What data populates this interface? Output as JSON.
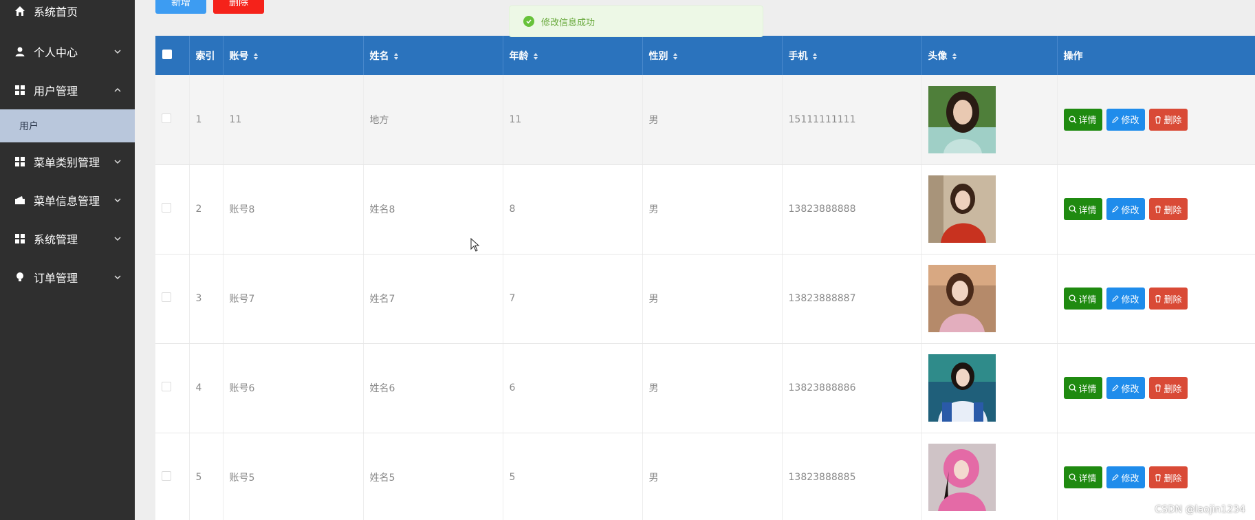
{
  "sidebar": {
    "items": [
      {
        "label": "系统首页",
        "icon": "home-icon"
      },
      {
        "label": "个人中心",
        "icon": "person-icon"
      },
      {
        "label": "用户管理",
        "icon": "grid-icon"
      },
      {
        "label": "菜单类别管理",
        "icon": "grid-icon"
      },
      {
        "label": "菜单信息管理",
        "icon": "wallet-icon"
      },
      {
        "label": "系统管理",
        "icon": "grid-icon"
      },
      {
        "label": "订单管理",
        "icon": "bulb-icon"
      }
    ],
    "sub_item": "用户"
  },
  "toolbar": {
    "add_label": "新增",
    "delete_label": "删除"
  },
  "toast": {
    "message": "修改信息成功"
  },
  "table": {
    "columns": [
      "索引",
      "账号",
      "姓名",
      "年龄",
      "性别",
      "手机",
      "头像",
      "操作"
    ],
    "rows": [
      {
        "index": "1",
        "account": "11",
        "name": "地方",
        "age": "11",
        "gender": "男",
        "phone": "15111111111"
      },
      {
        "index": "2",
        "account": "账号8",
        "name": "姓名8",
        "age": "8",
        "gender": "男",
        "phone": "13823888888"
      },
      {
        "index": "3",
        "account": "账号7",
        "name": "姓名7",
        "age": "7",
        "gender": "男",
        "phone": "13823888887"
      },
      {
        "index": "4",
        "account": "账号6",
        "name": "姓名6",
        "age": "6",
        "gender": "男",
        "phone": "13823888886"
      },
      {
        "index": "5",
        "account": "账号5",
        "name": "姓名5",
        "age": "5",
        "gender": "男",
        "phone": "13823888885"
      }
    ],
    "actions": {
      "detail": "详情",
      "edit": "修改",
      "delete": "删除"
    }
  },
  "watermark": "CSDN @laojin1234",
  "colors": {
    "sidebar_bg": "#2f2f2f",
    "header_bg": "#2b73bd",
    "detail_btn": "#1f8a10",
    "edit_btn": "#1f8ceb",
    "delete_btn": "#d94a36",
    "add_btn": "#3d9cf2",
    "toast_text": "#67a83a"
  }
}
